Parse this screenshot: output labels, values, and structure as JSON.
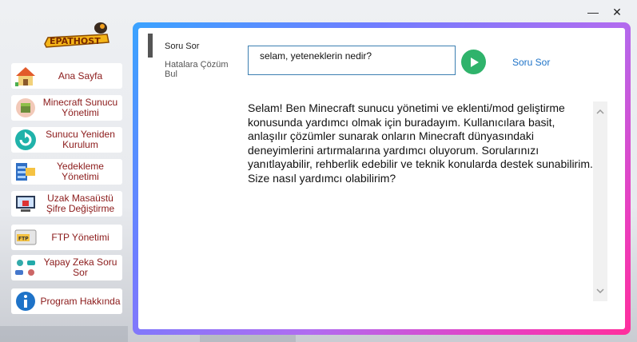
{
  "window": {
    "minimize_glyph": "—",
    "close_glyph": "✕"
  },
  "logo": {
    "text": "EPATHOST"
  },
  "sidebar": {
    "items": [
      {
        "label": "Ana Sayfa",
        "icon": "house-icon"
      },
      {
        "label": "Minecraft Sunucu Yönetimi",
        "icon": "minecraft-block-icon"
      },
      {
        "label": "Sunucu Yeniden Kurulum",
        "icon": "refresh-icon"
      },
      {
        "label": "Yedekleme Yönetimi",
        "icon": "backup-icon"
      },
      {
        "label": "Uzak Masaüstü Şifre Değiştirme",
        "icon": "remote-desktop-lock-icon"
      },
      {
        "label": "FTP Yönetimi",
        "icon": "ftp-icon"
      },
      {
        "label": "Yapay Zeka Soru Sor",
        "icon": "ai-robot-icon"
      },
      {
        "label": "Program Hakkında",
        "icon": "info-icon"
      }
    ]
  },
  "tabs": {
    "ask": "Soru Sor",
    "fix": "Hatalara Çözüm Bul"
  },
  "question": {
    "value": "selam, yeteneklerin nedir?"
  },
  "ask_link": "Soru Sor",
  "answer": "Selam! Ben Minecraft sunucu yönetimi ve eklenti/mod geliştirme konusunda yardımcı olmak için buradayım. Kullanıcılara basit, anlaşılır çözümler sunarak onların Minecraft dünyasındaki deneyimlerini artırmalarına yardımcı oluyorum. Sorularınızı yanıtlayabilir, rehberlik edebilir ve teknik konularda destek sunabilirim. Size nasıl yardımcı olabilirim?",
  "colors": {
    "accent_label": "#8b1a1a",
    "send_button": "#2fb36b",
    "link": "#1e73c8",
    "frame_gradient_start": "#3aa3ff",
    "frame_gradient_end": "#ff2f9c"
  }
}
